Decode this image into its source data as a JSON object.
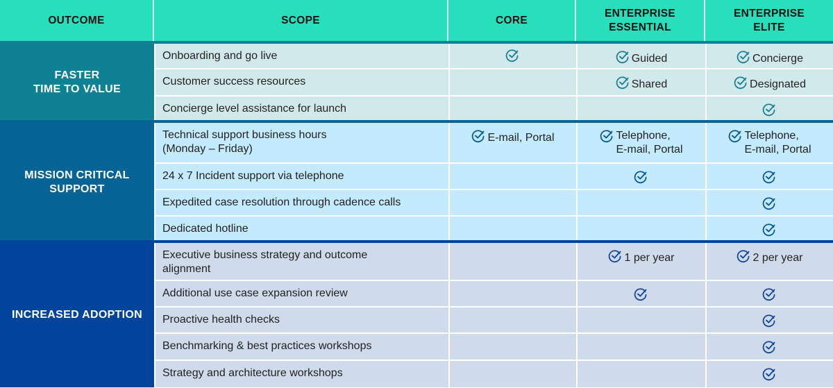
{
  "header": [
    "OUTCOME",
    "SCOPE",
    "CORE",
    "ENTERPRISE\nESSENTIAL",
    "ENTERPRISE\nELITE"
  ],
  "colors": {
    "header_bg": "#28dfbb",
    "g1_label": "#0e8195",
    "g1_row": "#d2e9eb",
    "g1_check": "#1d8193",
    "g2_label": "#056495",
    "g2_row": "#c4eafd",
    "g2_check": "#0a5a9a",
    "g3_label": "#00449b",
    "g3_row": "#cfdbea",
    "g3_check": "#15479c"
  },
  "groups": [
    {
      "label": "FASTER\nTIME TO VALUE",
      "rows": [
        {
          "scope": "Onboarding and go live",
          "core": {
            "check": true,
            "text": ""
          },
          "essential": {
            "check": true,
            "text": "Guided"
          },
          "elite": {
            "check": true,
            "text": "Concierge"
          }
        },
        {
          "scope": "Customer success resources",
          "core": {
            "check": false,
            "text": ""
          },
          "essential": {
            "check": true,
            "text": "Shared"
          },
          "elite": {
            "check": true,
            "text": "Designated"
          }
        },
        {
          "scope": "Concierge level assistance for launch",
          "core": {
            "check": false,
            "text": ""
          },
          "essential": {
            "check": false,
            "text": ""
          },
          "elite": {
            "check": true,
            "text": ""
          }
        }
      ]
    },
    {
      "label": "MISSION CRITICAL\nSUPPORT",
      "rows": [
        {
          "scope": "Technical support business hours\n(Monday – Friday)",
          "core": {
            "check": true,
            "text": "E-mail, Portal"
          },
          "essential": {
            "check": true,
            "text": "Telephone,\nE-mail, Portal"
          },
          "elite": {
            "check": true,
            "text": "Telephone,\nE-mail, Portal"
          }
        },
        {
          "scope": "24 x 7 Incident support via telephone",
          "core": {
            "check": false,
            "text": ""
          },
          "essential": {
            "check": true,
            "text": ""
          },
          "elite": {
            "check": true,
            "text": ""
          }
        },
        {
          "scope": "Expedited case resolution through cadence calls",
          "core": {
            "check": false,
            "text": ""
          },
          "essential": {
            "check": false,
            "text": ""
          },
          "elite": {
            "check": true,
            "text": ""
          }
        },
        {
          "scope": "Dedicated hotline",
          "core": {
            "check": false,
            "text": ""
          },
          "essential": {
            "check": false,
            "text": ""
          },
          "elite": {
            "check": true,
            "text": ""
          }
        }
      ]
    },
    {
      "label": "INCREASED ADOPTION",
      "rows": [
        {
          "scope": "Executive business strategy and outcome\nalignment",
          "core": {
            "check": false,
            "text": ""
          },
          "essential": {
            "check": true,
            "text": "1 per year"
          },
          "elite": {
            "check": true,
            "text": "2 per year"
          }
        },
        {
          "scope": "Additional use case expansion review",
          "core": {
            "check": false,
            "text": ""
          },
          "essential": {
            "check": true,
            "text": ""
          },
          "elite": {
            "check": true,
            "text": ""
          }
        },
        {
          "scope": "Proactive health checks",
          "core": {
            "check": false,
            "text": ""
          },
          "essential": {
            "check": false,
            "text": ""
          },
          "elite": {
            "check": true,
            "text": ""
          }
        },
        {
          "scope": "Benchmarking & best practices workshops",
          "core": {
            "check": false,
            "text": ""
          },
          "essential": {
            "check": false,
            "text": ""
          },
          "elite": {
            "check": true,
            "text": ""
          }
        },
        {
          "scope": "Strategy and architecture workshops",
          "core": {
            "check": false,
            "text": ""
          },
          "essential": {
            "check": false,
            "text": ""
          },
          "elite": {
            "check": true,
            "text": ""
          }
        }
      ]
    }
  ]
}
